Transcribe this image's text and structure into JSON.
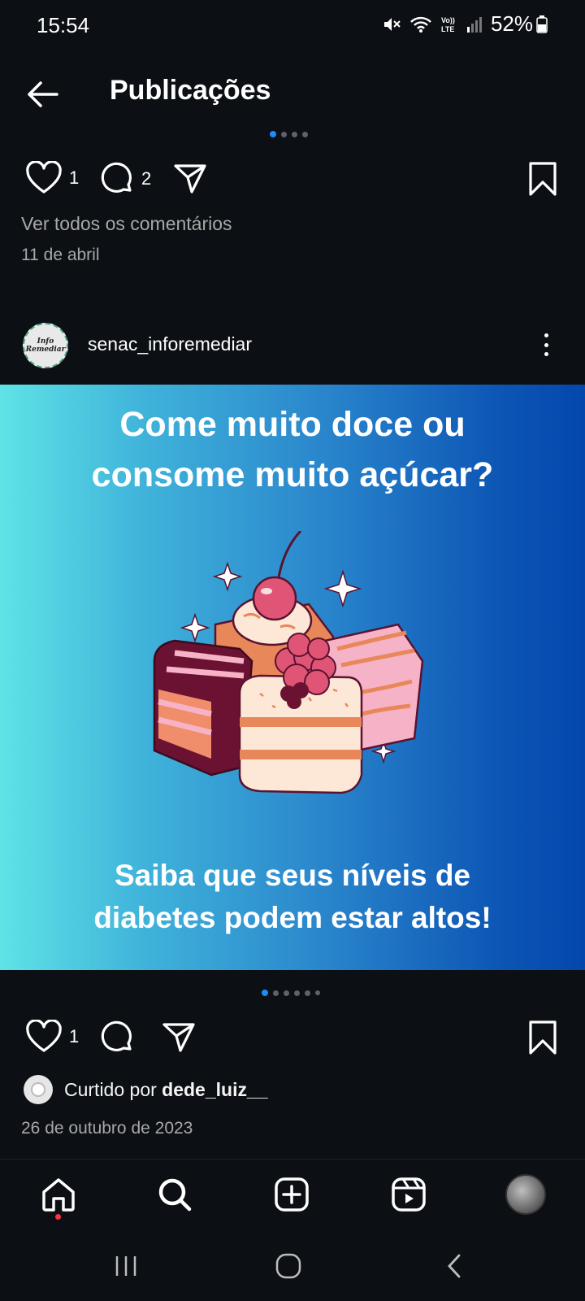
{
  "status": {
    "time": "15:54",
    "battery": "52%"
  },
  "header": {
    "title": "Publicações"
  },
  "prev_post": {
    "likes": "1",
    "comments": "2",
    "view_comments": "Ver todos os comentários",
    "date": "11 de abril"
  },
  "post": {
    "username": "senac_inforemediar",
    "avatar_text": "Info Remediar",
    "image_title_line1": "Come muito doce ou",
    "image_title_line2": "consome muito açúcar?",
    "image_sub_line1": "Saiba que seus níveis de",
    "image_sub_line2": "diabetes podem estar altos!",
    "likes": "1",
    "liked_by_prefix": "Curtido por ",
    "liked_by_user": "dede_luiz__",
    "date": "26 de outubro de 2023"
  },
  "colors": {
    "accent": "#1d8cf8",
    "background": "#0c0f14",
    "notification": "#ff3040"
  },
  "icons": {
    "back": "arrow-left-icon",
    "like": "heart-icon",
    "comment": "comment-icon",
    "share": "send-icon",
    "save": "bookmark-icon",
    "more": "more-vertical-icon",
    "nav": [
      "home-icon",
      "search-icon",
      "add-icon",
      "reels-icon",
      "profile-avatar"
    ]
  }
}
